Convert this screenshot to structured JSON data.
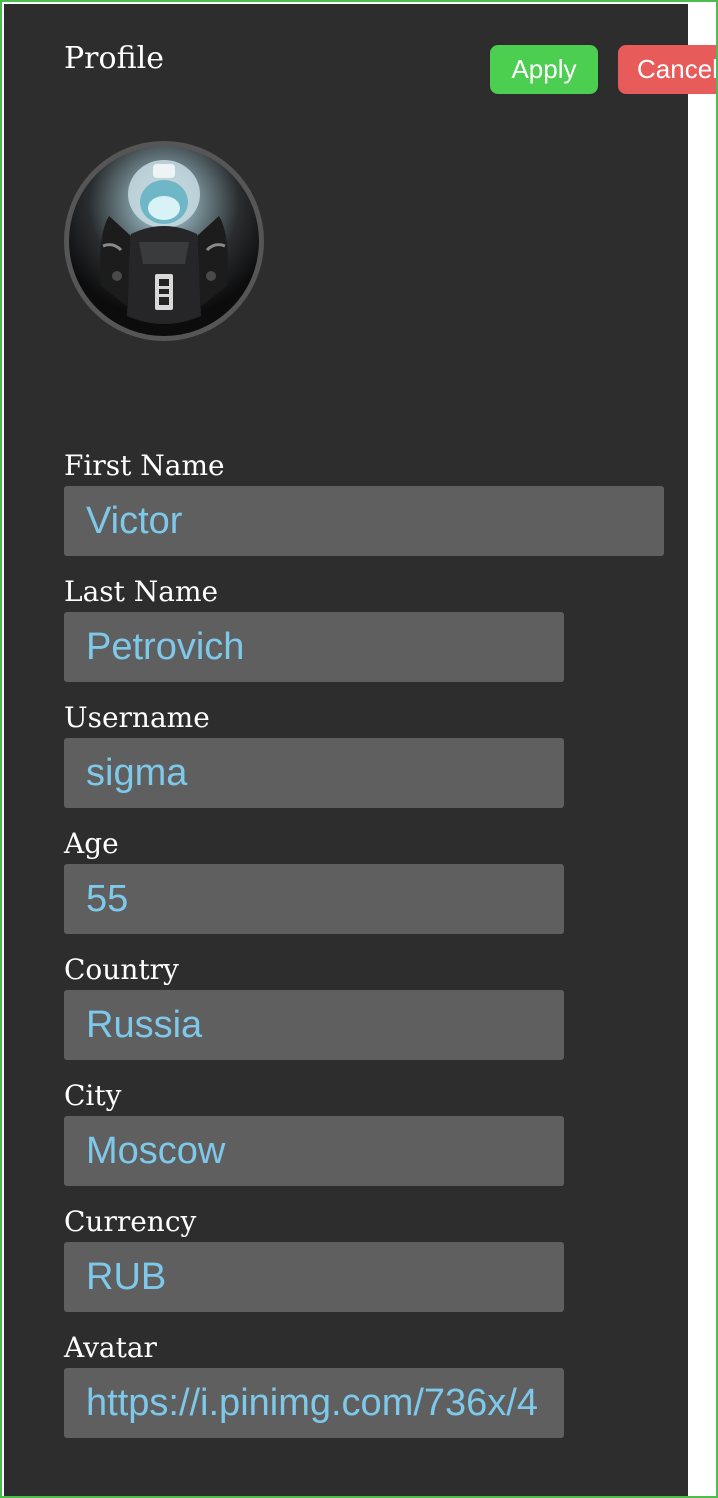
{
  "profile": {
    "title": "Profile",
    "apply_label": "Apply",
    "cancel_label": "Cancel",
    "avatar_icon": "space-marine-avatar"
  },
  "fields": {
    "first_name": {
      "label": "First Name",
      "value": "Victor"
    },
    "last_name": {
      "label": "Last Name",
      "value": "Petrovich"
    },
    "username": {
      "label": "Username",
      "value": "sigma"
    },
    "age": {
      "label": "Age",
      "value": "55"
    },
    "country": {
      "label": "Country",
      "value": "Russia"
    },
    "city": {
      "label": "City",
      "value": "Moscow"
    },
    "currency": {
      "label": "Currency",
      "value": "RUB"
    },
    "avatar": {
      "label": "Avatar",
      "value": "https://i.pinimg.com/736x/4"
    }
  },
  "colors": {
    "panel_bg": "#2d2d2d",
    "input_bg": "#5f5f5f",
    "input_text": "#7ec8ea",
    "apply": "#4ccf50",
    "cancel": "#e85b5b",
    "frame_border": "#4dbd4d"
  }
}
